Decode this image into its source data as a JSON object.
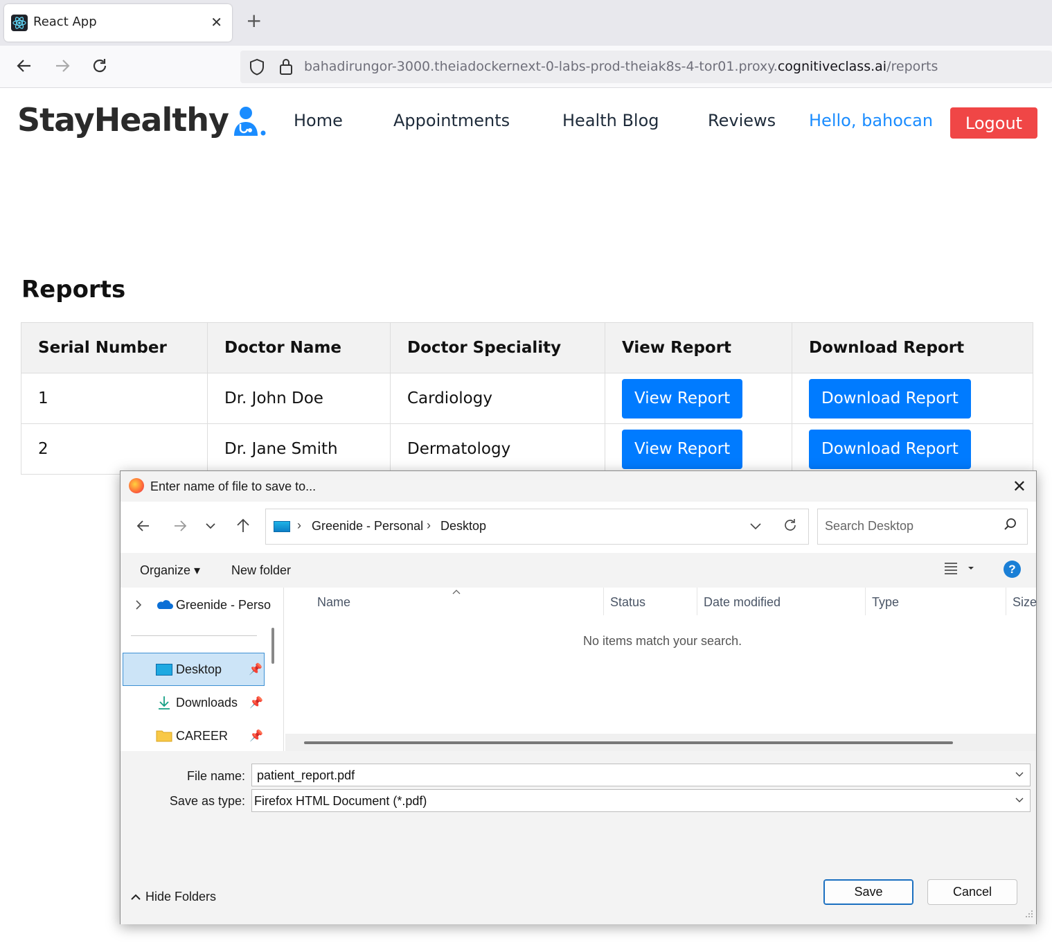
{
  "browser": {
    "tab_title": "React App",
    "tab_close": "✕",
    "new_tab": "+",
    "url_prefix": "bahadirungor-3000.theiadockernext-0-labs-prod-theiak8s-4-tor01.proxy.",
    "url_domain": "cognitiveclass.ai",
    "url_path": "/reports"
  },
  "app": {
    "logo": "StayHealthy",
    "menu": [
      "Home",
      "Appointments",
      "Health Blog",
      "Reviews"
    ],
    "greeting": "Hello, bahocan",
    "logout": "Logout",
    "page_title": "Reports"
  },
  "table": {
    "headers": [
      "Serial Number",
      "Doctor Name",
      "Doctor Speciality",
      "View Report",
      "Download Report"
    ],
    "rows": [
      {
        "serial": "1",
        "doctor": "Dr. John Doe",
        "speciality": "Cardiology",
        "view": "View Report",
        "download": "Download Report"
      },
      {
        "serial": "2",
        "doctor": "Dr. Jane Smith",
        "speciality": "Dermatology",
        "view": "View Report",
        "download": "Download Report"
      }
    ]
  },
  "dialog": {
    "title": "Enter name of file to save to...",
    "close": "✕",
    "breadcrumb": [
      "Greenide - Personal",
      "Desktop"
    ],
    "search_placeholder": "Search Desktop",
    "organize": "Organize ▾",
    "new_folder": "New folder",
    "nav": {
      "cloud": "Greenide - Perso",
      "items": [
        "Desktop",
        "Downloads",
        "CAREER"
      ]
    },
    "columns": [
      "Name",
      "Status",
      "Date modified",
      "Type",
      "Size"
    ],
    "empty_message": "No items match your search.",
    "file_name_label": "File name:",
    "file_name_value": "patient_report.pdf",
    "save_type_label": "Save as type:",
    "save_type_value": "Firefox HTML Document (*.pdf)",
    "hide_folders": "Hide Folders",
    "save": "Save",
    "cancel": "Cancel"
  },
  "colors": {
    "primary_button": "#007bff",
    "logout_button": "#f04646",
    "greeting": "#1a8cff"
  }
}
